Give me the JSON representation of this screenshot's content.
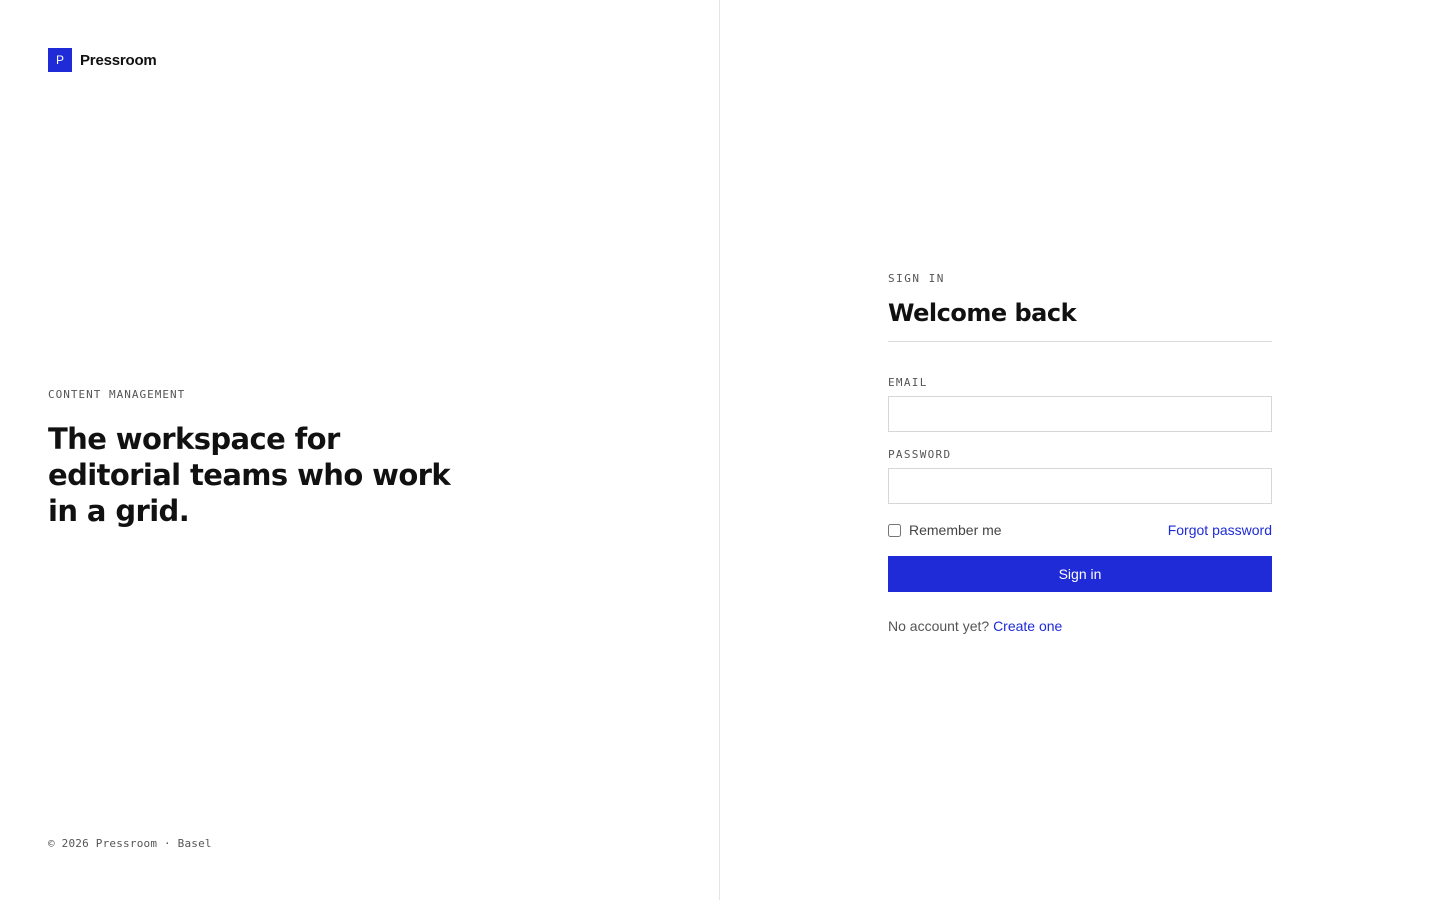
{
  "brand": {
    "mark": "P",
    "name": "Pressroom",
    "accent_color": "#1e2bd6"
  },
  "hero": {
    "eyebrow": "CONTENT MANAGEMENT",
    "title": "The workspace for editorial teams who work in a grid."
  },
  "footer": {
    "note": "© 2026 Pressroom · Basel"
  },
  "signin": {
    "eyebrow": "SIGN IN",
    "title": "Welcome back",
    "email_label": "EMAIL",
    "email_value": "",
    "password_label": "PASSWORD",
    "password_value": "",
    "remember_label": "Remember me",
    "remember_checked": false,
    "forgot_label": "Forgot password",
    "submit_label": "Sign in",
    "signup_prompt": "No account yet?",
    "signup_link": "Create one"
  }
}
